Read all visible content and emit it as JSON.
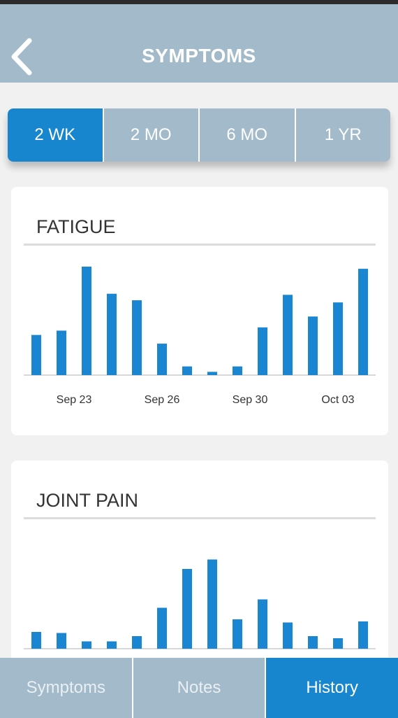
{
  "header": {
    "title": "SYMPTOMS"
  },
  "range_tabs": [
    {
      "label": "2 WK",
      "active": true
    },
    {
      "label": "2 MO",
      "active": false
    },
    {
      "label": "6 MO",
      "active": false
    },
    {
      "label": "1 YR",
      "active": false
    }
  ],
  "tabs": [
    {
      "label": "Symptoms",
      "active": false
    },
    {
      "label": "Notes",
      "active": false
    },
    {
      "label": "History",
      "active": true
    }
  ],
  "colors": {
    "accent": "#1786cf",
    "header_bg": "#a2bac9",
    "bar": "#1a85d0"
  },
  "chart_data": [
    {
      "type": "bar",
      "title": "FATIGUE",
      "x_ticks": [
        "Sep 23",
        "Sep 26",
        "Sep 30",
        "Oct 03"
      ],
      "values": [
        3.7,
        4.1,
        10,
        7.5,
        6.9,
        2.9,
        0.8,
        0.3,
        0.8,
        4.4,
        7.4,
        5.4,
        6.7,
        9.8
      ],
      "ylim": [
        0,
        10
      ],
      "grid": false
    },
    {
      "type": "bar",
      "title": "JOINT PAIN",
      "values": [
        1.6,
        1.5,
        0.7,
        0.7,
        1.2,
        3.9,
        7.6,
        8.5,
        2.8,
        4.7,
        2.5,
        1.2,
        1.0,
        2.6
      ],
      "ylim": [
        0,
        10
      ],
      "grid": false
    }
  ]
}
